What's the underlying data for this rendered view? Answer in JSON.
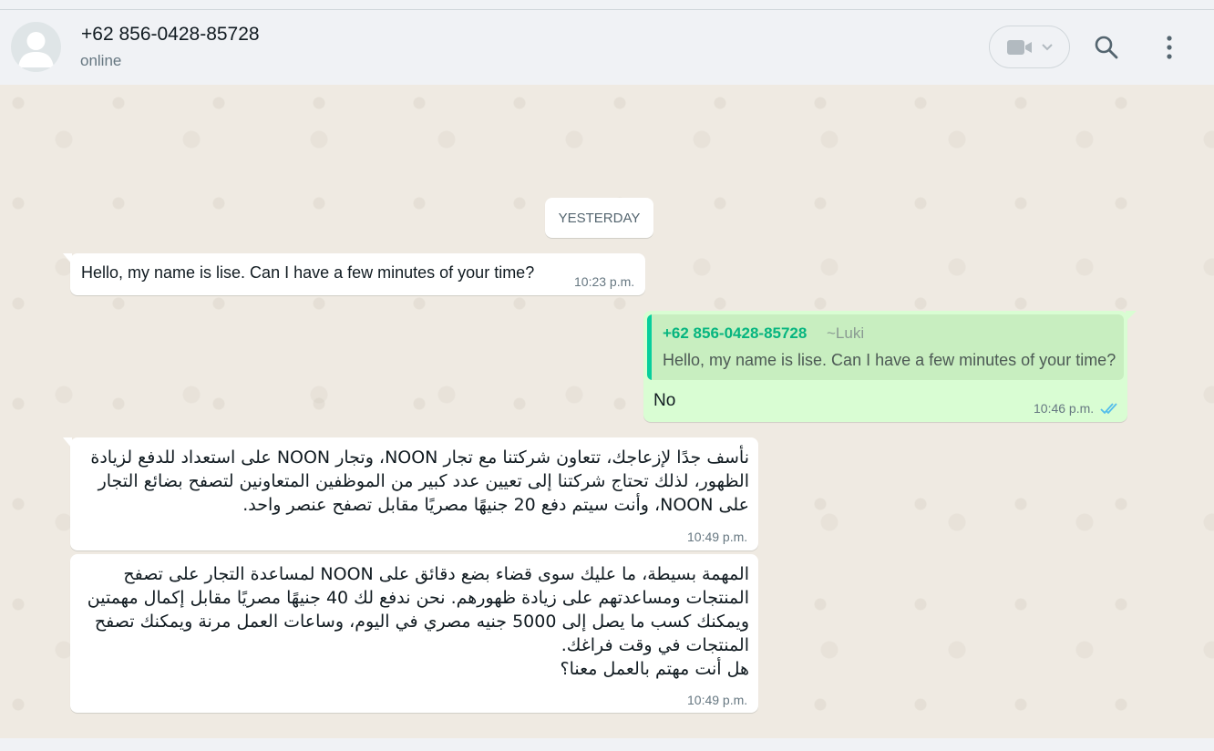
{
  "header": {
    "contact_name": "+62 856-0428-85728",
    "contact_status": "online",
    "icons": [
      "default-avatar-icon",
      "video-call-icon",
      "chevron-down-icon",
      "search-icon",
      "kebab-menu-icon"
    ]
  },
  "colors": {
    "chat_background": "#efeae2",
    "incoming_bubble": "#ffffff",
    "outgoing_bubble": "#d9fdd3",
    "quote_accent": "#06cf9c",
    "read_ticks": "#53bdeb"
  },
  "chat": {
    "date_separator": "YESTERDAY",
    "messages": [
      {
        "direction": "incoming",
        "text": "Hello, my name is lise. Can I have a few minutes of your time?",
        "time": "10:23 p.m."
      },
      {
        "direction": "outgoing",
        "quote_author": "+62 856-0428-85728",
        "quote_alias": "~Luki",
        "quote_text": "Hello, my name is lise. Can I have a few minutes of your time?",
        "text": "No",
        "time": "10:46 p.m.",
        "status": "read"
      },
      {
        "direction": "incoming",
        "lines": [
          "نأسف جدًا لإزعاجك، تتعاون شركتنا مع تجار NOON، وتجار NOON على استعداد للدفع لزيادة",
          "الظهور، لذلك تحتاج شركتنا إلى تعيين عدد كبير من الموظفين المتعاونين لتصفح بضائع التجار",
          "على NOON، وأنت سيتم دفع 20 جنيهًا مصريًا مقابل تصفح عنصر واحد."
        ],
        "time": "10:49 p.m."
      },
      {
        "direction": "incoming",
        "lines": [
          "المهمة بسيطة، ما عليك سوى قضاء بضع دقائق على NOON لمساعدة التجار على تصفح",
          "المنتجات ومساعدتهم على زيادة ظهورهم. نحن ندفع لك 40 جنيهًا مصريًا مقابل إكمال مهمتين",
          "ويمكنك كسب ما يصل إلى 5000 جنيه مصري في اليوم، وساعات العمل مرنة ويمكنك تصفح",
          "المنتجات في وقت فراغك.",
          "هل أنت مهتم بالعمل معنا؟"
        ],
        "time": "10:49 p.m."
      }
    ]
  }
}
